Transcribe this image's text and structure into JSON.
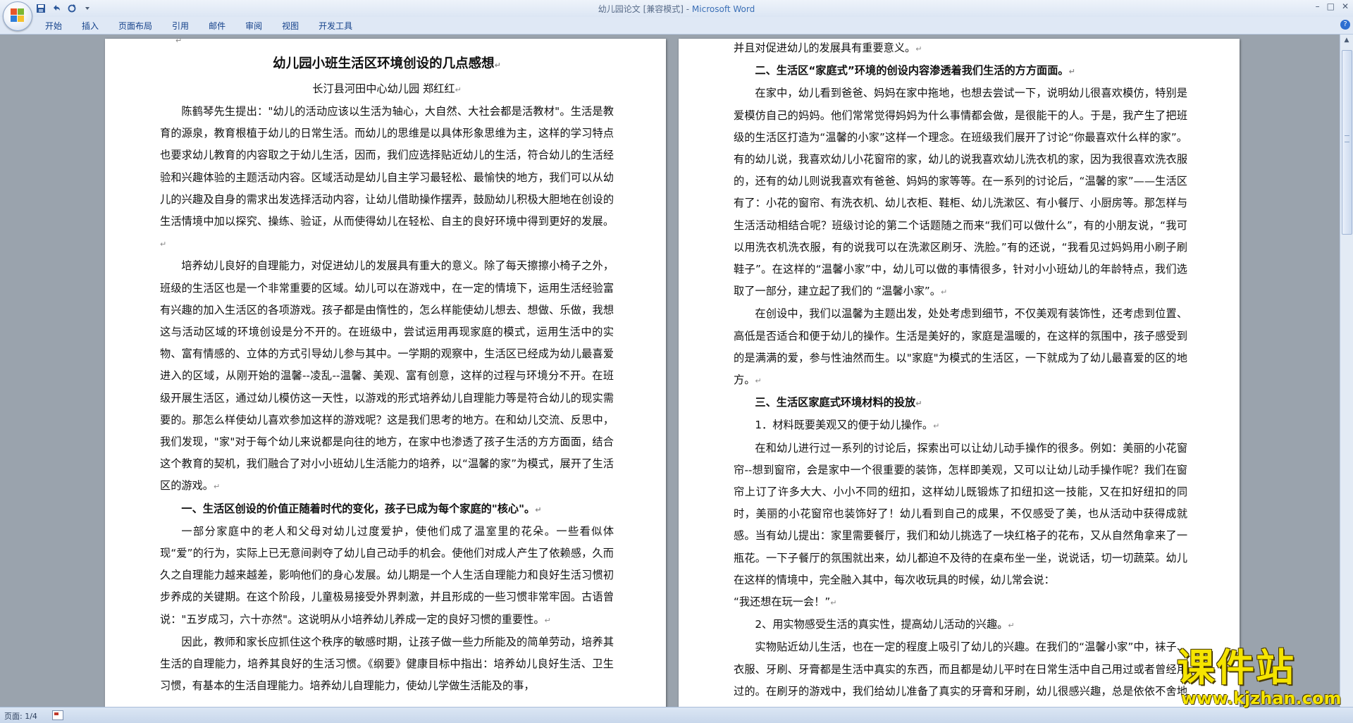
{
  "window": {
    "title_doc": "幼儿园论文 [兼容模式] - ",
    "title_app": "Microsoft Word"
  },
  "ribbon": {
    "tabs": [
      "开始",
      "插入",
      "页面布局",
      "引用",
      "邮件",
      "审阅",
      "视图",
      "开发工具"
    ]
  },
  "icons": {
    "office_button": "office-logo-icon",
    "save": "save-icon",
    "undo": "undo-icon",
    "redo": "redo-icon",
    "customize": "qat-dropdown-icon",
    "help": "help-icon"
  },
  "page1": {
    "title": "幼儿园小班生活区环境创设的几点感想",
    "author": "长汀县河田中心幼儿园   郑红红",
    "paragraphs": [
      "陈鹤琴先生提出：\"幼儿的活动应该以生活为轴心，大自然、大社会都是活教材\"。生活是教育的源泉，教育根植于幼儿的日常生活。而幼儿的思维是以具体形象思维为主，这样的学习特点也要求幼儿教育的内容取之于幼儿生活，因而，我们应选择贴近幼儿的生活，符合幼儿的生活经验和兴趣体验的主题活动内容。区域活动是幼儿自主学习最轻松、最愉快的地方，我们可以从幼儿的兴趣及自身的需求出发选择活动内容，让幼儿借助操作摆弄，鼓励幼儿积极大胆地在创设的生活情境中加以探究、操练、验证，从而使得幼儿在轻松、自主的良好环境中得到更好的发展。",
      "培养幼儿良好的自理能力，对促进幼儿的发展具有重大的意义。除了每天擦擦小椅子之外，班级的生活区也是一个非常重要的区域。幼儿可以在游戏中，在一定的情境下，运用生活经验富有兴趣的加入生活区的各项游戏。孩子都是由惰性的，怎么样能使幼儿想去、想做、乐做，我想这与活动区域的环境创设是分不开的。在班级中，尝试运用再现家庭的模式，运用生活中的实物、富有情感的、立体的方式引导幼儿参与其中。一学期的观察中，生活区已经成为幼儿最喜爱进入的区域，从刚开始的温馨--凌乱--温馨、美观、富有创意，这样的过程与环境分不开。在班级开展生活区，通过幼儿模仿这一天性，以游戏的形式培养幼儿自理能力等是符合幼儿的现实需要的。那怎么样使幼儿喜欢参加这样的游戏呢？这是我们思考的地方。在和幼儿交流、反思中，我们发现，\"家\"对于每个幼儿来说都是向往的地方，在家中也渗透了孩子生活的方方面面，结合这个教育的契机，我们融合了对小小班幼儿生活能力的培养，以“温馨的家”为模式，展开了生活区的游戏。",
      "一、生活区创设的价值正随着时代的变化，孩子已成为每个家庭的\"核心\"。",
      "一部分家庭中的老人和父母对幼儿过度爱护，使他们成了温室里的花朵。一些看似体现“爱”的行为，实际上已无意间剥夺了幼儿自己动手的机会。使他们对成人产生了依赖感，久而久之自理能力越来越差，影响他们的身心发展。幼儿期是一个人生活自理能力和良好生活习惯初步养成的关键期。在这个阶段，儿童极易接受外界刺激，并且形成的一些习惯非常牢固。古语曾说：\"五岁成习，六十亦然\"。这说明从小培养幼儿养成一定的良好习惯的重要性。",
      "因此，教师和家长应抓住这个秩序的敏感时期，让孩子做一些力所能及的简单劳动，培养其生活的自理能力，培养其良好的生活习惯。《纲要》健康目标中指出：培养幼儿良好生活、卫生习惯，有基本的生活自理能力。培养幼儿自理能力，使幼儿学做生活能及的事，"
    ]
  },
  "page2": {
    "paragraphs": [
      "并且对促进幼儿的发展具有重要意义。",
      "二、生活区“家庭式”环境的创设内容渗透着我们生活的方方面面。",
      "在家中，幼儿看到爸爸、妈妈在家中拖地，也想去尝试一下，说明幼儿很喜欢模仿，特别是爱模仿自己的妈妈。他们常常觉得妈妈为什么事情都会做，是很能干的人。于是，我产生了把班级的生活区打造为“温馨的小家”这样一个理念。在班级我们展开了讨论“你最喜欢什么样的家”。有的幼儿说，我喜欢幼儿小花窗帘的家，幼儿的说我喜欢幼儿洗衣机的家，因为我很喜欢洗衣服的，还有的幼儿则说我喜欢有爸爸、妈妈的家等等。在一系列的讨论后，“温馨的家”——生活区有了：小花的窗帘、有洗衣机、幼儿衣柜、鞋柜、幼儿洗漱区、有小餐厅、小厨房等。那怎样与生活活动相结合呢？班级讨论的第二个话题随之而来“我们可以做什么”，有的小朋友说，“我可以用洗衣机洗衣服，有的说我可以在洗漱区刷牙、洗脸。”有的还说，“我看见过妈妈用小刷子刷鞋子”。在这样的“温馨小家”中，幼儿可以做的事情很多，针对小小班幼儿的年龄特点，我们选取了一部分，建立起了我们的 “温馨小家”。",
      "在创设中，我们以温馨为主题出发，处处考虑到细节，不仅美观有装饰性，还考虑到位置、高低是否适合和便于幼儿的操作。生活是美好的，家庭是温暖的，在这样的氛围中，孩子感受到的是满满的爱，参与性油然而生。以\"家庭\"为模式的生活区，一下就成为了幼儿最喜爱的区的地方。",
      "三、生活区家庭式环境材料的投放",
      "1．材料既要美观又的便于幼儿操作。",
      "在和幼儿进行过一系列的讨论后，探索出可以让幼儿动手操作的很多。例如：美丽的小花窗帘--想到窗帘，会是家中一个很重要的装饰，怎样即美观，又可以让幼儿动手操作呢？我们在窗帘上订了许多大大、小小不同的纽扣，这样幼儿既锻炼了扣纽扣这一技能，又在扣好纽扣的同时，美丽的小花窗帘也装饰好了！幼儿看到自己的成果，不仅感受了美，也从活动中获得成就感。当有幼儿提出：家里需要餐厅，我们和幼儿挑选了一块红格子的花布，又从自然角拿来了一瓶花。一下子餐厅的氛围就出来，幼儿都迫不及待的在桌布坐一坐，说说话，切一切蔬菜。幼儿在这样的情境中，完全融入其中，每次收玩具的时候，幼儿常会说：",
      "“我还想在玩一会！”",
      "2、用实物感受生活的真实性，提高幼儿活动的兴趣。",
      "实物贴近幼儿生活，也在一定的程度上吸引了幼儿的兴趣。在我们的“温馨小家”中，袜子、衣服、牙刷、牙膏都是生活中真实的东西，而且都是幼儿平时在日常生活中自己用过或者曾经用过的。在刷牙的游戏中，我们给幼儿准备了真实的牙膏和牙刷，幼儿很感兴趣，总是依依不舍地来刷牙，幼儿会说“在家里，都是爸爸、妈妈帮我挤牙膏的，我最喜欢挤牙膏了！”可爱的小脸"
    ]
  },
  "paragraph_mark": "↵",
  "status": {
    "page": "页面: 1/4"
  },
  "watermark": {
    "title": "课件站",
    "url": "www.kjzhan.com"
  }
}
